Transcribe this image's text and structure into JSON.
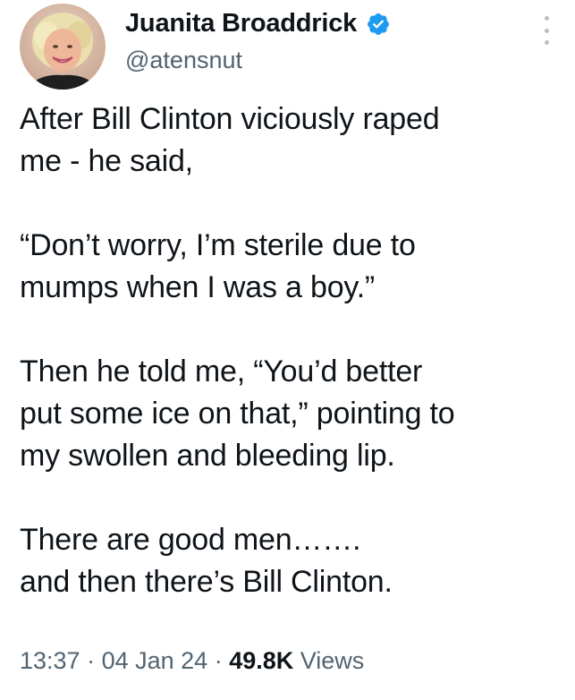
{
  "author": {
    "display_name": "Juanita Broaddrick",
    "handle": "@atensnut",
    "verified": true,
    "verified_color": "#1d9bf0"
  },
  "tweet": {
    "paragraphs": [
      "After Bill Clinton viciously raped\nme - he said,",
      "“Don’t worry, I’m sterile due to\nmumps when I was a boy.”",
      "Then he told me, “You’d better\nput some ice on that,” pointing to\nmy swollen and bleeding lip.",
      "There are good men…….\nand then there’s Bill Clinton."
    ]
  },
  "meta": {
    "time": "13:37",
    "separator": " · ",
    "date": "04 Jan 24",
    "views_count": "49.8K",
    "views_label": " Views"
  },
  "icons": {
    "verified": "verified-badge-icon",
    "more": "more-options-icon"
  }
}
